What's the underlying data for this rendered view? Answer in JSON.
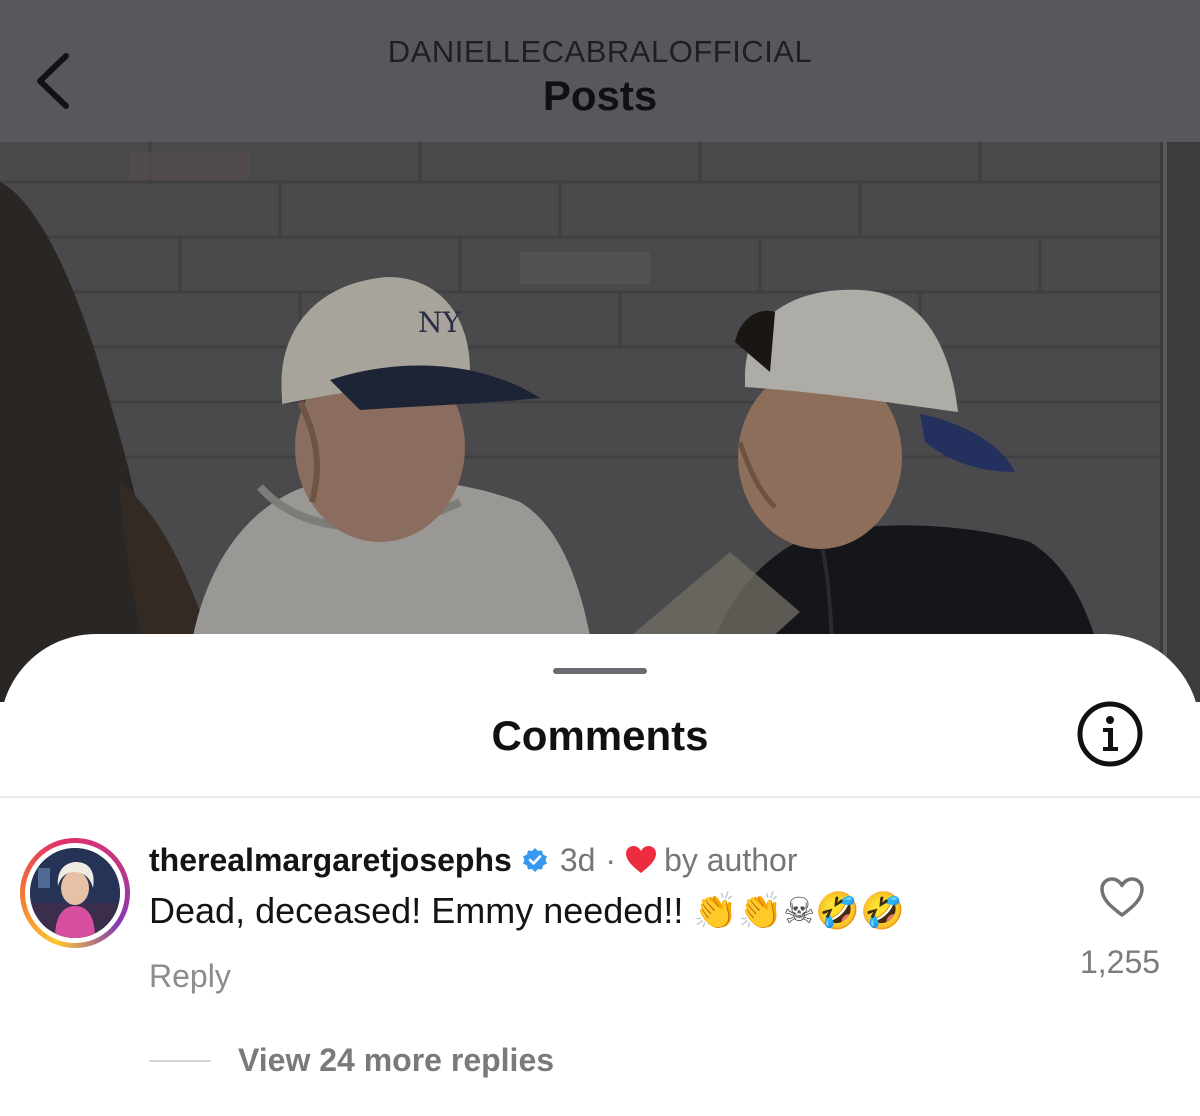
{
  "header": {
    "account": "DANIELLECABRALOFFICIAL",
    "title": "Posts"
  },
  "comments_sheet": {
    "title": "Comments"
  },
  "comment": {
    "username": "therealmargaretjosephs",
    "time": "3d",
    "separator": "·",
    "liked_label": "by author",
    "text": "Dead, deceased! Emmy needed!! ",
    "emojis": [
      "👏",
      "👏",
      "☠",
      "🤣",
      "🤣"
    ],
    "reply_label": "Reply",
    "like_count": "1,255",
    "view_replies": "View 24 more replies"
  },
  "colors": {
    "header_bg": "#57585c",
    "verified": "#3897f0",
    "author_heart": "#ed2d3f"
  },
  "icons": [
    "back-chevron-icon",
    "info-icon",
    "verified-badge-icon",
    "heart-icon",
    "heart-outline-icon"
  ]
}
